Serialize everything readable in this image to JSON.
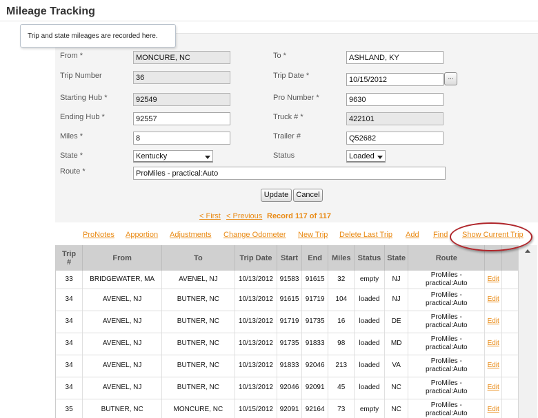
{
  "page": {
    "title": "Mileage Tracking"
  },
  "tooltip": {
    "text": "Trip and state mileages are recorded here."
  },
  "form": {
    "from": {
      "label": "From *",
      "value": "MONCURE, NC"
    },
    "to": {
      "label": "To *",
      "value": "ASHLAND, KY"
    },
    "trip_number": {
      "label": "Trip Number",
      "value": "36"
    },
    "trip_date": {
      "label": "Trip Date *",
      "value": "10/15/2012",
      "picker": "..."
    },
    "starting_hub": {
      "label": "Starting Hub *",
      "value": "92549"
    },
    "pro_number": {
      "label": "Pro Number *",
      "value": "9630"
    },
    "ending_hub": {
      "label": "Ending Hub *",
      "value": "92557"
    },
    "truck": {
      "label": "Truck # *",
      "value": "422101"
    },
    "miles": {
      "label": "Miles *",
      "value": "8"
    },
    "trailer": {
      "label": "Trailer #",
      "value": "Q52682"
    },
    "state": {
      "label": "State *",
      "value": "Kentucky"
    },
    "status": {
      "label": "Status",
      "value": "Loaded"
    },
    "route": {
      "label": "Route *",
      "value": "ProMiles - practical:Auto"
    },
    "update_label": "Update",
    "cancel_label": "Cancel"
  },
  "pager": {
    "first": "< First",
    "previous": "< Previous",
    "record": "Record 117 of 117"
  },
  "links": [
    "ProNotes",
    "Apportion",
    "Adjustments",
    "Change Odometer",
    "New Trip",
    "Delete Last Trip",
    "Add",
    "Find",
    "Show Current Trip"
  ],
  "grid": {
    "headers": [
      "Trip #",
      "From",
      "To",
      "Trip Date",
      "Start",
      "End",
      "Miles",
      "Status",
      "State",
      "Route",
      "",
      ""
    ],
    "rows": [
      {
        "trip": "33",
        "from": "BRIDGEWATER, MA",
        "to": "AVENEL, NJ",
        "date": "10/13/2012",
        "start": "91583",
        "end": "91615",
        "miles": "32",
        "status": "empty",
        "state": "NJ",
        "route": "ProMiles - practical:Auto",
        "edit": "Edit"
      },
      {
        "trip": "34",
        "from": "AVENEL, NJ",
        "to": "BUTNER, NC",
        "date": "10/13/2012",
        "start": "91615",
        "end": "91719",
        "miles": "104",
        "status": "loaded",
        "state": "NJ",
        "route": "ProMiles - practical:Auto",
        "edit": "Edit"
      },
      {
        "trip": "34",
        "from": "AVENEL, NJ",
        "to": "BUTNER, NC",
        "date": "10/13/2012",
        "start": "91719",
        "end": "91735",
        "miles": "16",
        "status": "loaded",
        "state": "DE",
        "route": "ProMiles - practical:Auto",
        "edit": "Edit"
      },
      {
        "trip": "34",
        "from": "AVENEL, NJ",
        "to": "BUTNER, NC",
        "date": "10/13/2012",
        "start": "91735",
        "end": "91833",
        "miles": "98",
        "status": "loaded",
        "state": "MD",
        "route": "ProMiles - practical:Auto",
        "edit": "Edit"
      },
      {
        "trip": "34",
        "from": "AVENEL, NJ",
        "to": "BUTNER, NC",
        "date": "10/13/2012",
        "start": "91833",
        "end": "92046",
        "miles": "213",
        "status": "loaded",
        "state": "VA",
        "route": "ProMiles - practical:Auto",
        "edit": "Edit"
      },
      {
        "trip": "34",
        "from": "AVENEL, NJ",
        "to": "BUTNER, NC",
        "date": "10/13/2012",
        "start": "92046",
        "end": "92091",
        "miles": "45",
        "status": "loaded",
        "state": "NC",
        "route": "ProMiles - practical:Auto",
        "edit": "Edit"
      },
      {
        "trip": "35",
        "from": "BUTNER, NC",
        "to": "MONCURE, NC",
        "date": "10/15/2012",
        "start": "92091",
        "end": "92164",
        "miles": "73",
        "status": "empty",
        "state": "NC",
        "route": "ProMiles - practical:Auto",
        "edit": "Edit"
      }
    ]
  },
  "colors": {
    "link": "#e98a14",
    "highlight": "#b0262b",
    "header_bg": "#d0d0d0"
  }
}
